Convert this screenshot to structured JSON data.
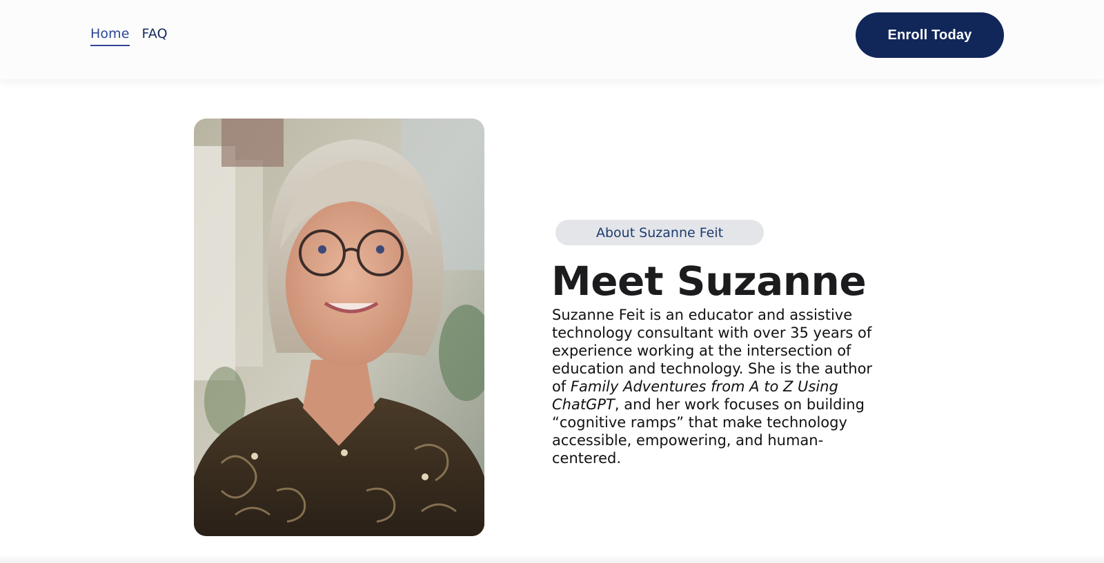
{
  "nav": {
    "items": [
      {
        "label": "Home",
        "active": true
      },
      {
        "label": "FAQ",
        "active": false
      }
    ],
    "cta_label": "Enroll Today"
  },
  "about": {
    "pill_label": "About Suzanne Feit",
    "heading": "Meet Suzanne",
    "bio": {
      "part1": "Suzanne Feit is an educator and assistive technology consultant with over 35 years of experience working at the intersection of education and technology. She is the author of ",
      "book_title": "Family Adventures from A to Z Using ChatGPT",
      "part2": ", and her work focuses on building “cognitive ramps” that make technology accessible, empowering, and human-centered."
    }
  },
  "colors": {
    "brand_navy": "#11275a",
    "link_blue": "#2a4496",
    "pill_bg": "#e3e5e9"
  },
  "icons": {
    "portrait": "portrait-photo"
  }
}
